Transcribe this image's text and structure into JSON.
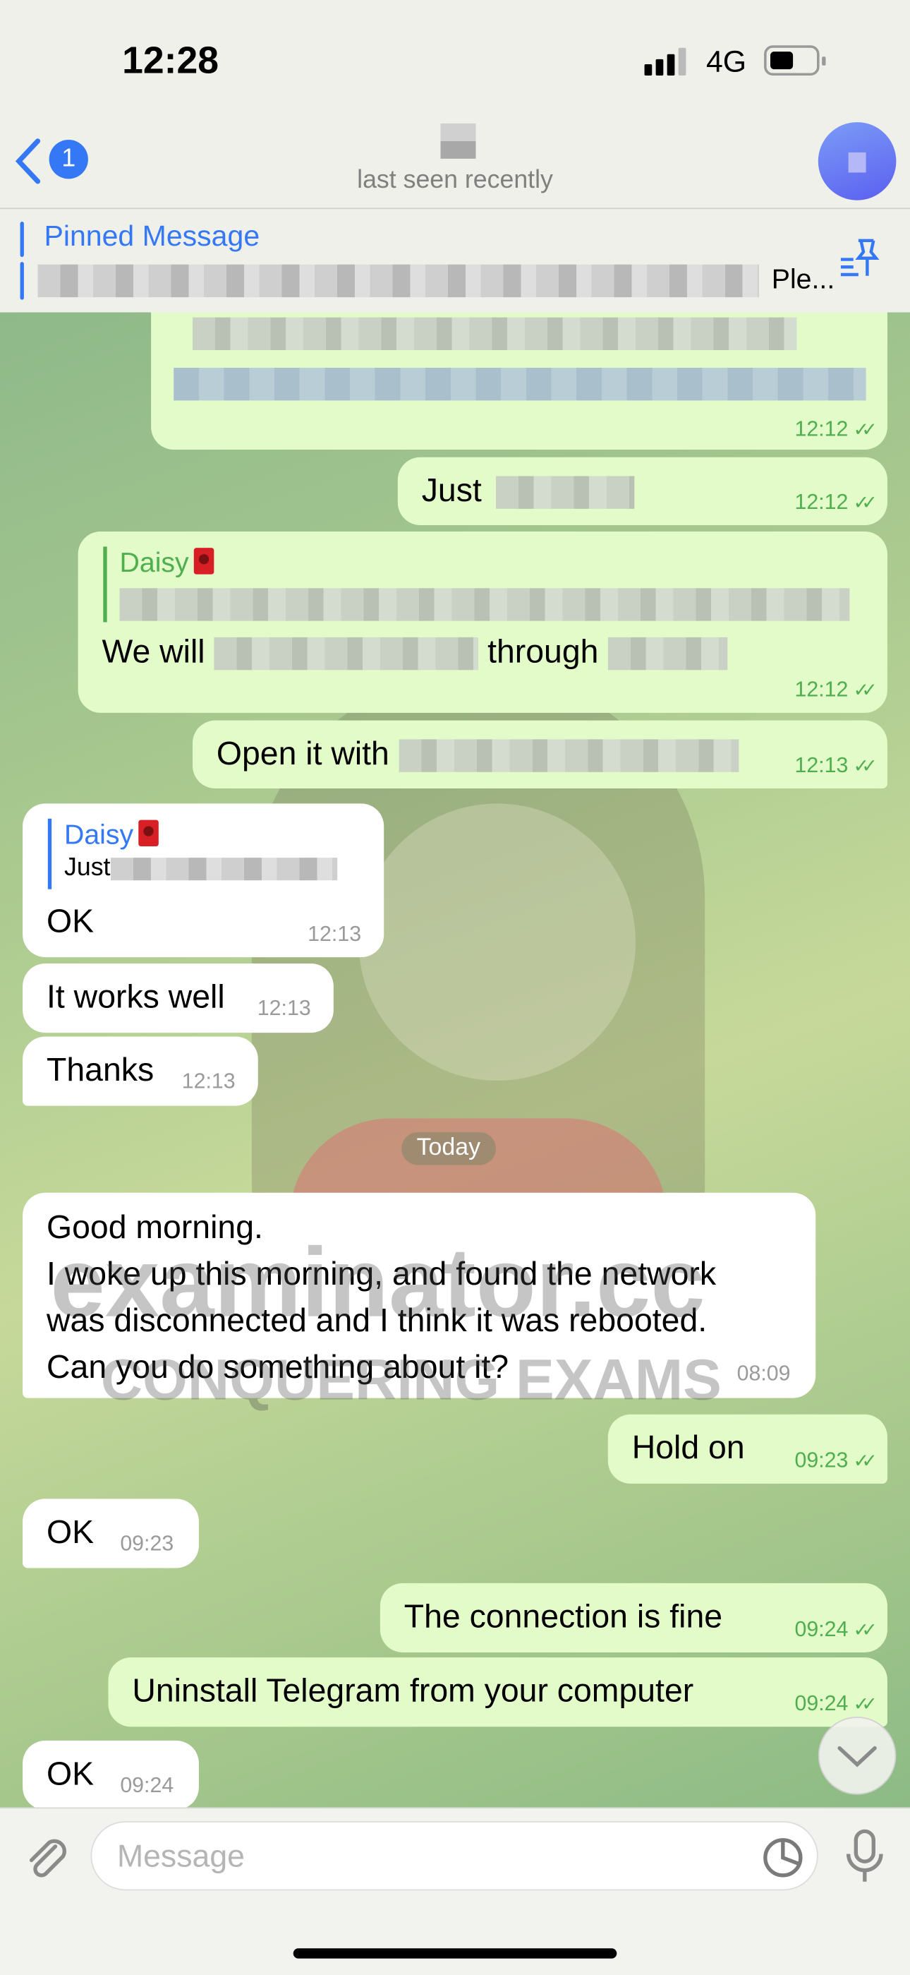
{
  "status_bar": {
    "time": "12:28",
    "network": "4G"
  },
  "header": {
    "back_badge": "1",
    "status": "last seen recently"
  },
  "pinned": {
    "title": "Pinned Message",
    "preview_tail": "Ple..."
  },
  "messages": [
    {
      "dir": "out",
      "time": "12:12"
    },
    {
      "dir": "out",
      "text": "Just",
      "time": "12:12"
    },
    {
      "dir": "out",
      "reply_name": "Daisy",
      "text_a": "We will",
      "text_b": "through",
      "time": "12:12"
    },
    {
      "dir": "out",
      "text": "Open it with",
      "time": "12:13"
    },
    {
      "dir": "in",
      "reply_name": "Daisy",
      "reply_text": "Just",
      "text": "OK",
      "time": "12:13"
    },
    {
      "dir": "in",
      "text": "It works well",
      "time": "12:13"
    },
    {
      "dir": "in",
      "text": "Thanks",
      "time": "12:13"
    },
    {
      "dir": "in",
      "lines": [
        "Good morning.",
        "I woke up this morning, and found the network",
        "was disconnected and I think it was rebooted.",
        "Can you do something about it?"
      ],
      "time": "08:09"
    },
    {
      "dir": "out",
      "text": "Hold on",
      "time": "09:23"
    },
    {
      "dir": "in",
      "text": "OK",
      "time": "09:23"
    },
    {
      "dir": "out",
      "text": "The connection is fine",
      "time": "09:24"
    },
    {
      "dir": "out",
      "text": "Uninstall Telegram from your computer",
      "time": "09:24"
    },
    {
      "dir": "in",
      "text": "OK",
      "time": "09:24"
    }
  ],
  "date_separator": "Today",
  "watermark": {
    "line1": "examinator.cc",
    "line2": "CONQUERING EXAMS"
  },
  "composer": {
    "placeholder": "Message"
  },
  "colors": {
    "accent": "#3478f6",
    "outgoing": "#e3fbc9",
    "incoming": "#ffffff",
    "outgoing_time": "#4fae4e",
    "reply_green": "#4fae4e"
  }
}
